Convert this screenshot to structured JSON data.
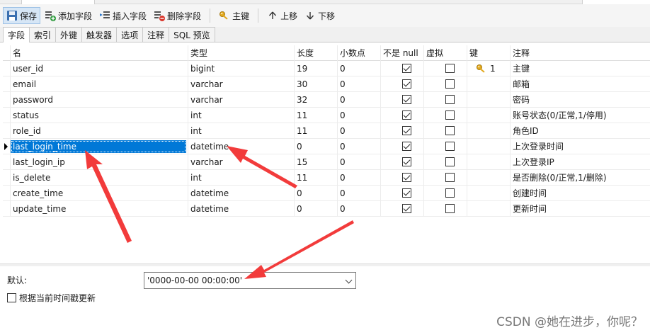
{
  "toolbar": {
    "save": "保存",
    "add_field": "添加字段",
    "insert_field": "插入字段",
    "delete_field": "删除字段",
    "primary_key": "主键",
    "move_up": "上移",
    "move_down": "下移"
  },
  "tabs": [
    "字段",
    "索引",
    "外键",
    "触发器",
    "选项",
    "注释",
    "SQL 预览"
  ],
  "columns": {
    "name": "名",
    "type": "类型",
    "length": "长度",
    "decimals": "小数点",
    "not_null": "不是 null",
    "virtual": "虚拟",
    "key": "键",
    "comment": "注释"
  },
  "rows": [
    {
      "name": "user_id",
      "type": "bigint",
      "length": "19",
      "decimals": "0",
      "not_null": true,
      "virtual": false,
      "key": "1",
      "comment": "主键"
    },
    {
      "name": "email",
      "type": "varchar",
      "length": "30",
      "decimals": "0",
      "not_null": true,
      "virtual": false,
      "key": "",
      "comment": "邮箱"
    },
    {
      "name": "password",
      "type": "varchar",
      "length": "32",
      "decimals": "0",
      "not_null": true,
      "virtual": false,
      "key": "",
      "comment": "密码"
    },
    {
      "name": "status",
      "type": "int",
      "length": "11",
      "decimals": "0",
      "not_null": true,
      "virtual": false,
      "key": "",
      "comment": "账号状态(0/正常,1/停用)"
    },
    {
      "name": "role_id",
      "type": "int",
      "length": "11",
      "decimals": "0",
      "not_null": true,
      "virtual": false,
      "key": "",
      "comment": "角色ID"
    },
    {
      "name": "last_login_time",
      "type": "datetime",
      "length": "0",
      "decimals": "0",
      "not_null": true,
      "virtual": false,
      "key": "",
      "comment": "上次登录时间",
      "selected": true
    },
    {
      "name": "last_login_ip",
      "type": "varchar",
      "length": "15",
      "decimals": "0",
      "not_null": true,
      "virtual": false,
      "key": "",
      "comment": "上次登录IP"
    },
    {
      "name": "is_delete",
      "type": "int",
      "length": "11",
      "decimals": "0",
      "not_null": true,
      "virtual": false,
      "key": "",
      "comment": "是否删除(0/正常,1/删除)"
    },
    {
      "name": "create_time",
      "type": "datetime",
      "length": "0",
      "decimals": "0",
      "not_null": true,
      "virtual": false,
      "key": "",
      "comment": "创建时间"
    },
    {
      "name": "update_time",
      "type": "datetime",
      "length": "0",
      "decimals": "0",
      "not_null": true,
      "virtual": false,
      "key": "",
      "comment": "更新时间"
    }
  ],
  "properties": {
    "default_label": "默认:",
    "default_value": "'0000-00-00 00:00:00'",
    "update_on_timestamp": "根据当前时间戳更新"
  },
  "watermark": "CSDN @她在进步，你呢？",
  "colors": {
    "selection": "#0078d7",
    "annotation_arrow": "#f23b3b"
  }
}
